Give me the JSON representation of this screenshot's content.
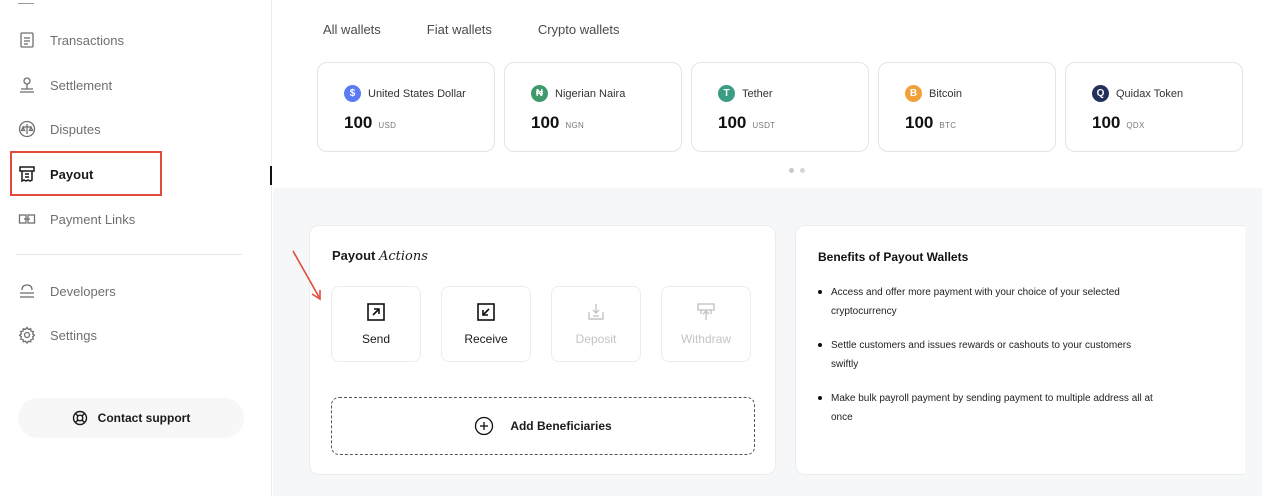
{
  "sidebar": {
    "items": [
      {
        "label": "Transactions",
        "icon": "document-icon"
      },
      {
        "label": "Settlement",
        "icon": "bank-icon"
      },
      {
        "label": "Disputes",
        "icon": "scale-icon"
      },
      {
        "label": "Payout",
        "icon": "receipt-icon"
      },
      {
        "label": "Payment Links",
        "icon": "link-icon"
      },
      {
        "label": "Developers",
        "icon": "server-icon"
      },
      {
        "label": "Settings",
        "icon": "gear-icon"
      }
    ],
    "active": "Payout",
    "contact_support": "Contact support"
  },
  "wallet_tabs": [
    "All wallets",
    "Fiat wallets",
    "Crypto wallets"
  ],
  "wallets": [
    {
      "name": "United States Dollar",
      "amount": "100",
      "currency": "USD",
      "color": "#5a7cf2",
      "glyph": "$"
    },
    {
      "name": "Nigerian Naira",
      "amount": "100",
      "currency": "NGN",
      "color": "#3f9a6b",
      "glyph": "₦"
    },
    {
      "name": "Tether",
      "amount": "100",
      "currency": "USDT",
      "color": "#3a9d84",
      "glyph": "T"
    },
    {
      "name": "Bitcoin",
      "amount": "100",
      "currency": "BTC",
      "color": "#f2a13a",
      "glyph": "B"
    },
    {
      "name": "Quidax Token",
      "amount": "100",
      "currency": "QDX",
      "color": "#23305c",
      "glyph": "Q"
    }
  ],
  "payout_actions": {
    "title_plain": "Payout",
    "title_script": "Actions",
    "actions": [
      {
        "label": "Send",
        "enabled": true
      },
      {
        "label": "Receive",
        "enabled": true
      },
      {
        "label": "Deposit",
        "enabled": false
      },
      {
        "label": "Withdraw",
        "enabled": false
      }
    ],
    "add_beneficiaries": "Add Beneficiaries"
  },
  "benefits": {
    "title": "Benefits of Payout Wallets",
    "items": [
      "Access and offer more payment with your choice of your selected cryptocurrency",
      "Settle customers and issues rewards or cashouts to your customers swiftly",
      "Make bulk payroll payment by sending payment to multiple address all at once"
    ]
  },
  "colors": {
    "highlight": "#e24b3b",
    "page_bg": "#f6f7f9"
  }
}
